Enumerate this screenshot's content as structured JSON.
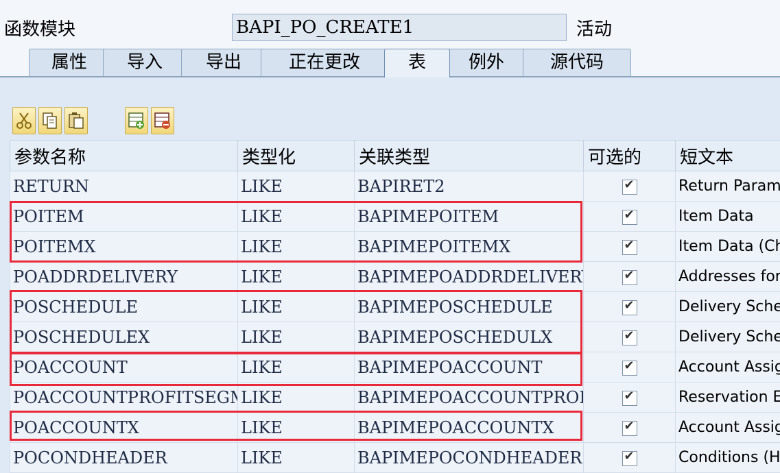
{
  "header": {
    "fm_label": "函数模块",
    "fm_value": "BAPI_PO_CREATE1",
    "status": "活动"
  },
  "tabs": [
    "属性",
    "导入",
    "导出",
    "正在更改",
    "表",
    "例外",
    "源代码"
  ],
  "active_tab": "表",
  "toolbar": {
    "icons": [
      "cut-icon",
      "copy-icon",
      "paste-icon",
      "insert-row-icon",
      "delete-row-icon"
    ]
  },
  "table": {
    "columns": [
      "参数名称",
      "类型化",
      "关联类型",
      "可选的",
      "短文本"
    ],
    "rows": [
      {
        "name": "RETURN",
        "typing": "LIKE",
        "assoc": "BAPIRET2",
        "optional": true,
        "text": "Return Param"
      },
      {
        "name": "POITEM",
        "typing": "LIKE",
        "assoc": "BAPIMEPOITEM",
        "optional": true,
        "text": "Item Data"
      },
      {
        "name": "POITEMX",
        "typing": "LIKE",
        "assoc": "BAPIMEPOITEMX",
        "optional": true,
        "text": "Item Data (Ch"
      },
      {
        "name": "POADDRDELIVERY",
        "typing": "LIKE",
        "assoc": "BAPIMEPOADDRDELIVERY",
        "optional": true,
        "text": "Addresses for"
      },
      {
        "name": "POSCHEDULE",
        "typing": "LIKE",
        "assoc": "BAPIMEPOSCHEDULE",
        "optional": true,
        "text": "Delivery Sche"
      },
      {
        "name": "POSCHEDULEX",
        "typing": "LIKE",
        "assoc": "BAPIMEPOSCHEDULX",
        "optional": true,
        "text": "Delivery Sche"
      },
      {
        "name": "POACCOUNT",
        "typing": "LIKE",
        "assoc": "BAPIMEPOACCOUNT",
        "optional": true,
        "text": "Account Assig"
      },
      {
        "name": "POACCOUNTPROFITSEGM…",
        "typing": "LIKE",
        "assoc": "BAPIMEPOACCOUNTPROF…",
        "optional": true,
        "text": "Reservation E"
      },
      {
        "name": "POACCOUNTX",
        "typing": "LIKE",
        "assoc": "BAPIMEPOACCOUNTX",
        "optional": true,
        "text": "Account Assig"
      },
      {
        "name": "POCONDHEADER",
        "typing": "LIKE",
        "assoc": "BAPIMEPOCONDHEADER",
        "optional": true,
        "text": "Conditions (H"
      }
    ]
  },
  "colors": {
    "highlight": "#e8293a",
    "background": "#dfe9f5",
    "header_bg": "#f3f6fb"
  }
}
